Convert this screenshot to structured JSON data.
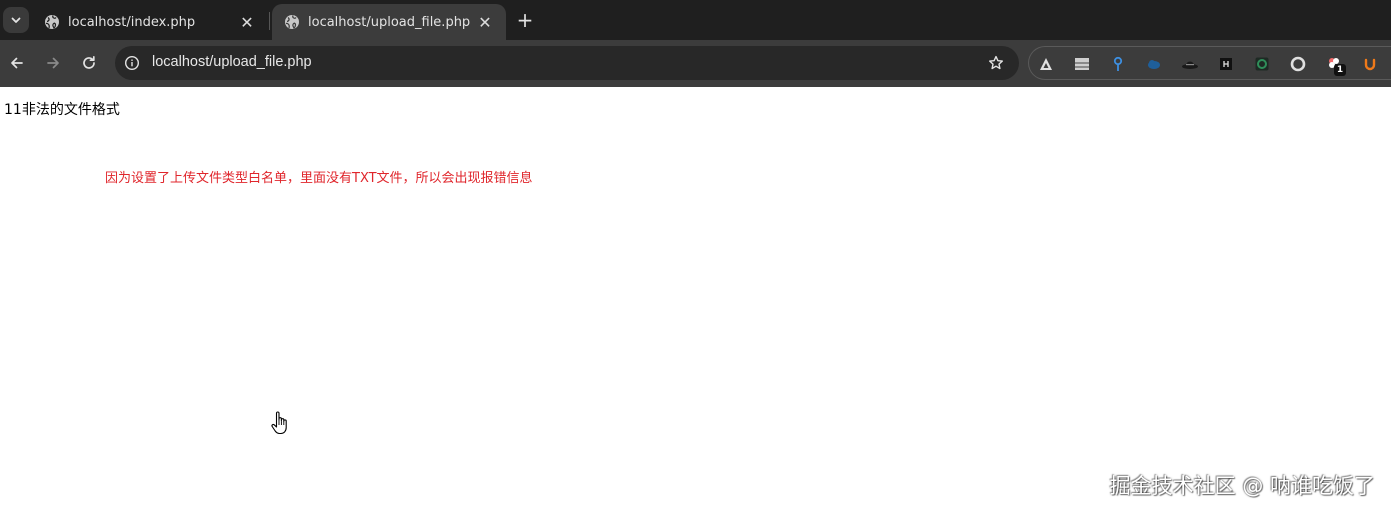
{
  "browser": {
    "tabs": [
      {
        "title": "localhost/index.php",
        "active": false
      },
      {
        "title": "localhost/upload_file.php",
        "active": true
      }
    ],
    "new_tab_symbol": "+",
    "close_symbol": "✕",
    "address_bar": {
      "url": "localhost/upload_file.php"
    },
    "extensions": [
      {
        "icon": "triangle-extension-icon",
        "color": "#e0e0e0"
      },
      {
        "icon": "stripes-extension-icon",
        "color": "#cfcfcf"
      },
      {
        "icon": "pin-extension-icon",
        "color": "#3d8fe0"
      },
      {
        "icon": "blue-cloud-extension-icon",
        "color": "#1f5f9a"
      },
      {
        "icon": "hat-extension-icon",
        "color": "#8a8a8a"
      },
      {
        "icon": "dark-square-extension-icon",
        "color": "#111111"
      },
      {
        "icon": "green-square-extension-icon",
        "color": "#2f8f5a"
      },
      {
        "icon": "ring-extension-icon",
        "color": "#e0e0e0"
      },
      {
        "icon": "flower-extension-icon",
        "color": "#f06a6a",
        "badge": "1"
      },
      {
        "icon": "orange-u-extension-icon",
        "color": "#f07a1a"
      }
    ]
  },
  "page": {
    "heading": "11非法的文件格式",
    "annotation": "因为设置了上传文件类型白名单，里面没有TXT文件，所以会出现报错信息",
    "annotation_color": "#e0262c"
  },
  "watermark": "掘金技术社区 @ 呐谁吃饭了"
}
